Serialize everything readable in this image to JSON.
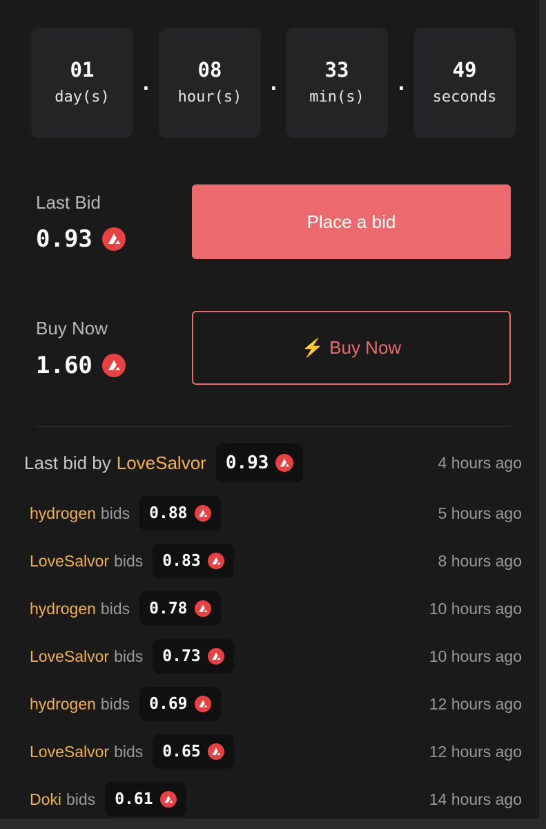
{
  "countdown": [
    {
      "value": "01",
      "unit": "day(s)"
    },
    {
      "value": "08",
      "unit": "hour(s)"
    },
    {
      "value": "33",
      "unit": "min(s)"
    },
    {
      "value": "49",
      "unit": "seconds"
    }
  ],
  "countdown_separator": ".",
  "last_bid": {
    "label": "Last Bid",
    "value": "0.93"
  },
  "buy_now": {
    "label": "Buy Now",
    "value": "1.60"
  },
  "buttons": {
    "place_bid": "Place a bid",
    "buy_now": "Buy Now"
  },
  "currency_icon": "avalanche-icon",
  "colors": {
    "accent": "#ec696d",
    "username": "#f0b34a",
    "currency": "#e84142",
    "bolt": "#f5b32a"
  },
  "summary": {
    "prefix": "Last bid by",
    "user": "LoveSalvor",
    "amount": "0.93",
    "time": "4 hours ago"
  },
  "bid_verb": "bids",
  "bids": [
    {
      "user": "hydrogen",
      "amount": "0.88",
      "time": "5 hours ago"
    },
    {
      "user": "LoveSalvor",
      "amount": "0.83",
      "time": "8 hours ago"
    },
    {
      "user": "hydrogen",
      "amount": "0.78",
      "time": "10 hours ago"
    },
    {
      "user": "LoveSalvor",
      "amount": "0.73",
      "time": "10 hours ago"
    },
    {
      "user": "hydrogen",
      "amount": "0.69",
      "time": "12 hours ago"
    },
    {
      "user": "LoveSalvor",
      "amount": "0.65",
      "time": "12 hours ago"
    },
    {
      "user": "Doki",
      "amount": "0.61",
      "time": "14 hours ago"
    }
  ]
}
